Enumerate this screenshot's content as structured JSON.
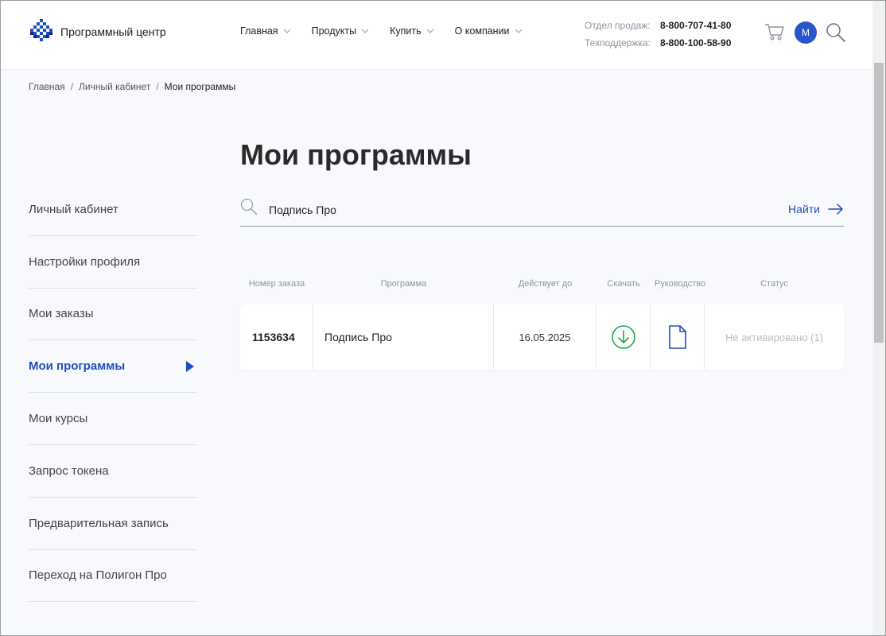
{
  "header": {
    "logo_text": "Программный центр",
    "nav": [
      "Главная",
      "Продукты",
      "Купить",
      "О компании"
    ],
    "contacts": [
      {
        "label": "Отдел продаж:",
        "phone": "8-800-707-41-80"
      },
      {
        "label": "Техподдержка:",
        "phone": "8-800-100-58-90"
      }
    ],
    "avatar_letter": "М",
    "icons": {
      "cart": "cart-icon",
      "search": "search-icon"
    }
  },
  "breadcrumb": [
    "Главная",
    "Личный кабинет",
    "Мои программы"
  ],
  "breadcrumb_separator": "/",
  "sidebar": {
    "items": [
      "Личный кабинет",
      "Настройки профиля",
      "Мои заказы",
      "Мои программы",
      "Мои курсы",
      "Запрос токена",
      "Предварительная запись",
      "Переход на Полигон Про"
    ],
    "active_index": 3
  },
  "main": {
    "title": "Мои программы",
    "search": {
      "value": "Подпись Про",
      "button": "Найти"
    },
    "table_headers": [
      "Номер заказа",
      "Программа",
      "Действует до",
      "Скачать",
      "Руководство",
      "Статус"
    ],
    "rows": [
      {
        "order": "1153634",
        "program": "Подпись Про",
        "valid_until": "16.05.2025",
        "status": "Не активировано (1)"
      }
    ]
  },
  "colors": {
    "accent": "#1f4fbf",
    "avatar": "#2a55c8",
    "download": "#21a84a",
    "status_inactive": "#b9bcc4"
  }
}
